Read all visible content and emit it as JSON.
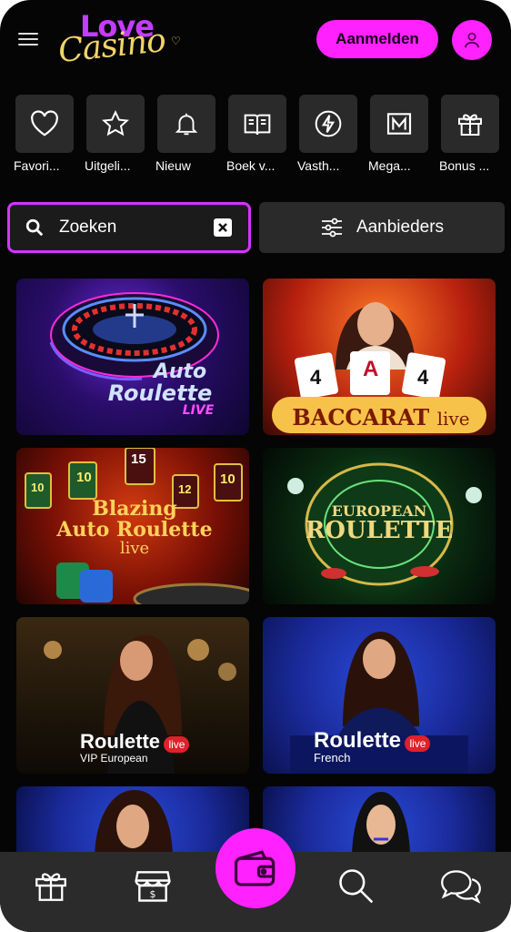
{
  "header": {
    "logo_love": "Love",
    "logo_casino": "Casino",
    "login_label": "Aanmelden"
  },
  "categories": [
    {
      "label": "Favori...",
      "icon": "heart-icon"
    },
    {
      "label": "Uitgeli...",
      "icon": "star-icon"
    },
    {
      "label": "Nieuw",
      "icon": "bell-icon"
    },
    {
      "label": "Boek v...",
      "icon": "book-icon"
    },
    {
      "label": "Vasth...",
      "icon": "lightning-icon"
    },
    {
      "label": "Mega...",
      "icon": "mega-icon"
    },
    {
      "label": "Bonus ...",
      "icon": "bonus-gift-icon"
    }
  ],
  "search": {
    "value": "Zoeken"
  },
  "providers_label": "Aanbieders",
  "games": [
    {
      "line1": "Auto",
      "line2": "Roulette",
      "line3": "LIVE"
    },
    {
      "line1": "BACCARAT",
      "line2": "live",
      "cards": [
        "4",
        "A",
        "4"
      ]
    },
    {
      "line1": "Blazing",
      "line2": "Auto Roulette",
      "line3": "live",
      "numbers": [
        "15",
        "10",
        "10",
        "12",
        "10"
      ]
    },
    {
      "line1": "EUROPEAN",
      "line2": "ROULETTE"
    },
    {
      "line1": "Roulette",
      "badge": "live",
      "line2": "VIP",
      "line3": "European"
    },
    {
      "line1": "Roulette",
      "badge": "live",
      "line2": "French"
    },
    {
      "line1": "",
      "line2": ""
    },
    {
      "line1": "",
      "line2": ""
    }
  ],
  "bottom_nav": [
    "gift-icon",
    "shop-icon",
    "wallet-icon",
    "search-icon",
    "chat-icon"
  ],
  "colors": {
    "accent": "#ff22ff",
    "background": "#050505",
    "tile": "#2a2a2a",
    "search_border": "#d633ff"
  }
}
